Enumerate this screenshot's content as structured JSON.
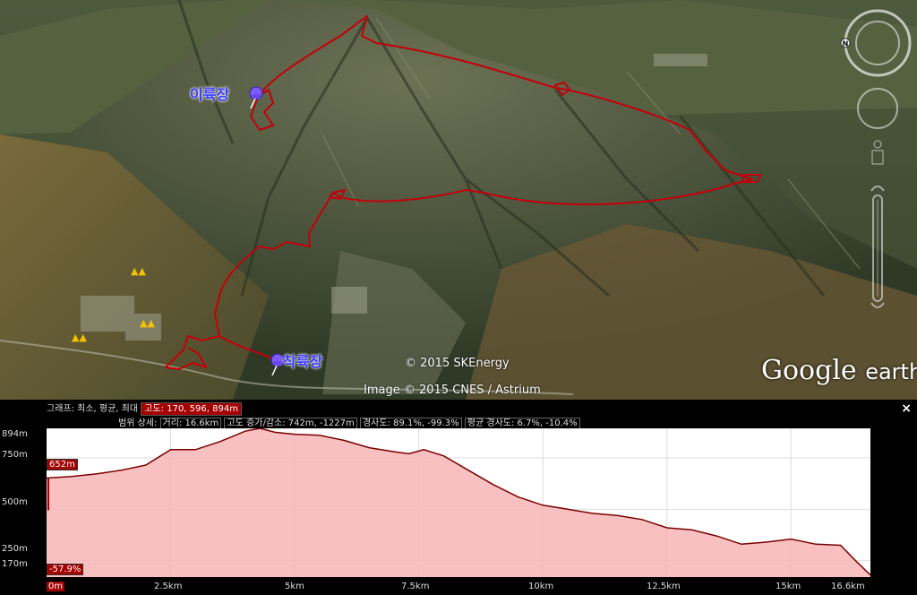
{
  "map": {
    "labels": {
      "takeoff": "이륙장",
      "landing": "착륙장"
    },
    "copyright_1": "© 2015 SKEnergy",
    "copyright_2": "Image © 2015 CNES / Astrium",
    "brand_google": "Google",
    "brand_earth": "earth",
    "track_color": "#c4000b"
  },
  "profile": {
    "graph_line_prefix": "그래프: 최소, 평균, 최대",
    "graph_line_value": "고도: 170, 596, 894m",
    "stats_prefix": "범위 상세:",
    "stats_distance": "거리: 16.6km",
    "stats_gain": "고도 증가/감소: 742m, -1227m",
    "stats_slope": "경사도: 89.1%, -99.3%",
    "stats_avg_slope": "평균 경사도: 6.7%, -10.4%",
    "close_label": "×",
    "current_elevation": "652m",
    "current_slope": "-57.9%",
    "highlight_x": "0m"
  },
  "chart_data": {
    "type": "area",
    "x_unit": "km",
    "y_unit": "m",
    "ylim": [
      170,
      894
    ],
    "xlim": [
      0,
      16.6
    ],
    "y_ticks": [
      "894m",
      "750m",
      "500m",
      "250m",
      "170m"
    ],
    "x_ticks": [
      "0m",
      "2.5km",
      "5km",
      "7.5km",
      "10km",
      "12.5km",
      "15km",
      "16.6km"
    ],
    "x": [
      0,
      0.5,
      1.0,
      1.5,
      2.0,
      2.3,
      2.5,
      3.0,
      3.5,
      4.0,
      4.3,
      4.6,
      5.0,
      5.5,
      6.0,
      6.5,
      7.0,
      7.3,
      7.6,
      8.0,
      8.5,
      9.0,
      9.5,
      10.0,
      10.5,
      11.0,
      11.5,
      12.0,
      12.5,
      13.0,
      13.5,
      14.0,
      14.5,
      15.0,
      15.5,
      16.0,
      16.3,
      16.6
    ],
    "y": [
      652,
      660,
      672,
      690,
      715,
      760,
      790,
      790,
      830,
      880,
      894,
      875,
      865,
      860,
      835,
      800,
      780,
      770,
      790,
      760,
      690,
      620,
      560,
      520,
      500,
      480,
      470,
      450,
      410,
      400,
      370,
      330,
      340,
      355,
      330,
      325,
      250,
      180
    ],
    "fill_color": "#f7b5b5",
    "line_color": "#7a0000"
  }
}
